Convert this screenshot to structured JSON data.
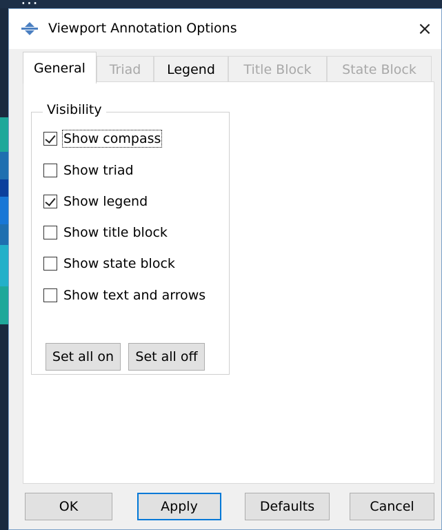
{
  "background": {
    "partial_text": "...",
    "mesh_colors": [
      "#1fa89a",
      "#1f6fb0",
      "#0b3f9c",
      "#1877d6",
      "#23b0c9"
    ]
  },
  "window": {
    "title": "Viewport Annotation Options",
    "close_glyph": "×",
    "icon": "app-logo-icon"
  },
  "tabs": [
    {
      "label": "General",
      "state": "active"
    },
    {
      "label": "Triad",
      "state": "disabled"
    },
    {
      "label": "Legend",
      "state": "enabled"
    },
    {
      "label": "Title Block",
      "state": "disabled"
    },
    {
      "label": "State Block",
      "state": "disabled"
    }
  ],
  "visibility": {
    "legend": "Visibility",
    "options": [
      {
        "label": "Show compass",
        "checked": true,
        "focused": true
      },
      {
        "label": "Show triad",
        "checked": false
      },
      {
        "label": "Show legend",
        "checked": true
      },
      {
        "label": "Show title block",
        "checked": false
      },
      {
        "label": "Show state block",
        "checked": false
      },
      {
        "label": "Show text and arrows",
        "checked": false
      }
    ],
    "set_all_on": "Set all on",
    "set_all_off": "Set all off"
  },
  "footer": {
    "ok": "OK",
    "apply": "Apply",
    "defaults": "Defaults",
    "cancel": "Cancel"
  },
  "colors": {
    "focus_border": "#0078d7"
  }
}
